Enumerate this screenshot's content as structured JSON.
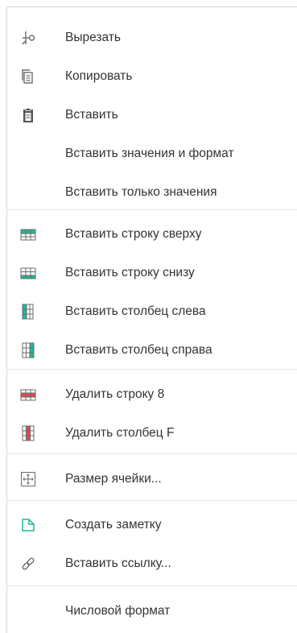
{
  "menu": {
    "items": [
      {
        "label": "Вырезать",
        "icon": "scissors-icon"
      },
      {
        "label": "Копировать",
        "icon": "copy-icon"
      },
      {
        "label": "Вставить",
        "icon": "paste-icon"
      },
      {
        "label": "Вставить значения и формат",
        "icon": ""
      },
      {
        "label": "Вставить только значения",
        "icon": ""
      },
      {
        "label": "Вставить строку сверху",
        "icon": "insert-row-above-icon"
      },
      {
        "label": "Вставить строку снизу",
        "icon": "insert-row-below-icon"
      },
      {
        "label": "Вставить столбец слева",
        "icon": "insert-column-left-icon"
      },
      {
        "label": "Вставить столбец справа",
        "icon": "insert-column-right-icon"
      },
      {
        "label": "Удалить строку 8",
        "icon": "delete-row-icon"
      },
      {
        "label": "Удалить столбец F",
        "icon": "delete-column-icon"
      },
      {
        "label": "Размер ячейки...",
        "icon": "cell-size-icon"
      },
      {
        "label": "Создать заметку",
        "icon": "note-icon"
      },
      {
        "label": "Вставить ссылку...",
        "icon": "link-icon"
      },
      {
        "label": "Числовой формат",
        "icon": ""
      }
    ]
  },
  "colors": {
    "text": "#333333",
    "icon_gray": "#6b6b6b",
    "insert_teal": "#1fb89a",
    "delete_red": "#e5484d",
    "separator": "#e3e3e3"
  }
}
